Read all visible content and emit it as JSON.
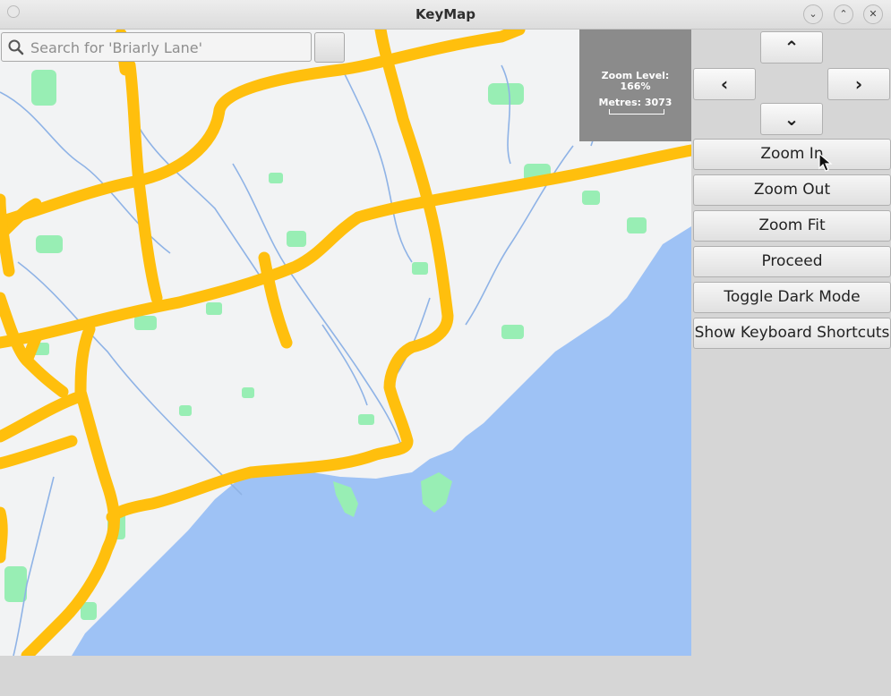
{
  "window": {
    "title": "KeyMap"
  },
  "window_controls": {
    "minimize_icon": "chevron-down-icon",
    "maximize_icon": "chevron-up-icon",
    "close_icon": "close-icon"
  },
  "search": {
    "placeholder": "Search for 'Briarly Lane'",
    "value": ""
  },
  "scale_panel": {
    "zoom_label": "Zoom Level:",
    "zoom_value": "166%",
    "metres_label": "Metres: 3073"
  },
  "nav": {
    "up": "⌃",
    "left": "‹",
    "right": "›",
    "down": "⌄"
  },
  "buttons": {
    "zoom_in": "Zoom In",
    "zoom_out": "Zoom Out",
    "zoom_fit": "Zoom Fit",
    "proceed": "Proceed",
    "toggle_dark_mode": "Toggle Dark Mode",
    "show_shortcuts": "Show Keyboard Shortcuts"
  },
  "colors": {
    "land": "#f2f3f4",
    "water": "#9ec2f5",
    "river": "#8fb3e6",
    "park": "#98eeb4",
    "highway": "#ffbf0d",
    "panel": "#8b8b8b"
  }
}
